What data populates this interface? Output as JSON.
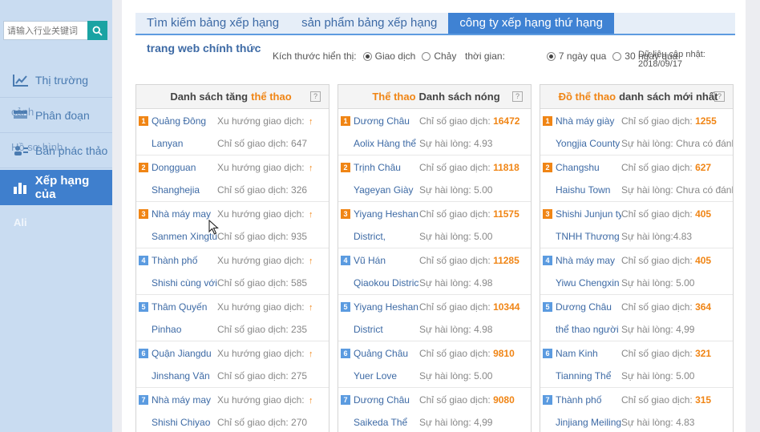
{
  "sidebar": {
    "search_placeholder": "请输入行业关键词",
    "items": [
      {
        "label": "Thị trường",
        "ghost": ""
      },
      {
        "label": "Phân đoạn",
        "ghost": "cảnh"
      },
      {
        "label": "Bản phác thảo",
        "ghost": "Hồ sơ hình"
      },
      {
        "label": "Xếp hạng của",
        "ghost": ""
      }
    ],
    "sub_label": "Ali"
  },
  "tabs": [
    {
      "label": "Tìm kiếm bảng xếp hạng",
      "active": false
    },
    {
      "label": "sản phẩm bảng xếp hạng",
      "active": false
    },
    {
      "label": "công ty xếp hạng thứ hạng",
      "active": true
    }
  ],
  "official_link": "trang web chính thức",
  "options": {
    "size_label": "Kích thước hiển thị:",
    "size_opts": [
      {
        "label": "Giao dịch",
        "checked": true
      },
      {
        "label": "Chảy",
        "checked": false
      }
    ],
    "time_label": "thời gian:",
    "time_opts": [
      {
        "label": "7 ngày qua",
        "checked": true
      },
      {
        "label": "30 ngày qua",
        "checked": false
      }
    ],
    "updated": "Dữ liệu cập nhật: 2018/09/17"
  },
  "panels": [
    {
      "title_before": "Danh sách tăng",
      "title_hl": "thể thao",
      "title_after": "",
      "rows": [
        {
          "rank": "1",
          "name": "Quảng Đông",
          "sub": "Lanyan",
          "m1_label": "Xu hướng giao dịch:",
          "m1_val": "",
          "m1_up": true,
          "m2": "Chỉ số giao dịch: 647"
        },
        {
          "rank": "2",
          "name": "Dongguan",
          "sub": "Shanghejia",
          "m1_label": "Xu hướng giao dịch:",
          "m1_val": "",
          "m1_up": true,
          "m2": "Chỉ số giao dịch: 326"
        },
        {
          "rank": "3",
          "name": "Nhà máy may",
          "sub": "Sanmen Xingtu",
          "m1_label": "Xu hướng giao dịch:",
          "m1_val": "",
          "m1_up": true,
          "m2": "Chỉ số giao dịch: 935"
        },
        {
          "rank": "4",
          "name": "Thành phố",
          "sub": "Shishi cùng với",
          "m1_label": "Xu hướng giao dịch:",
          "m1_val": "",
          "m1_up": true,
          "m2": "Chỉ số giao dịch: 585"
        },
        {
          "rank": "5",
          "name": "Thâm Quyến",
          "sub": "Pinhao",
          "m1_label": "Xu hướng giao dịch:",
          "m1_val": "",
          "m1_up": true,
          "m2": "Chỉ số giao dịch: 235"
        },
        {
          "rank": "6",
          "name": "Quận Jiangdu",
          "sub": "Jinshang Văn",
          "m1_label": "Xu hướng giao dịch:",
          "m1_val": "",
          "m1_up": true,
          "m2": "Chỉ số giao dịch: 275"
        },
        {
          "rank": "7",
          "name": "Nhà máy may",
          "sub": "Shishi Chiyao",
          "m1_label": "Xu hướng giao dịch:",
          "m1_val": "",
          "m1_up": true,
          "m2": "Chỉ số giao dịch: 270"
        }
      ]
    },
    {
      "title_before": "",
      "title_hl": "Thể thao",
      "title_after": "Danh sách nóng",
      "rows": [
        {
          "rank": "1",
          "name": "Dương Châu",
          "sub": "Aolix Hàng thể",
          "m1_label": "Chỉ số giao dịch:",
          "m1_val": "16472",
          "m1_up": false,
          "m2": "Sự hài lòng: 4.93"
        },
        {
          "rank": "2",
          "name": "Trịnh Châu",
          "sub": "Yageyan Giày",
          "m1_label": "Chỉ số giao dịch:",
          "m1_val": "11818",
          "m1_up": false,
          "m2": "Sự hài lòng: 5.00"
        },
        {
          "rank": "3",
          "name": "Yiyang Heshan",
          "sub": "District,",
          "m1_label": "Chỉ số giao dịch:",
          "m1_val": "11575",
          "m1_up": false,
          "m2": "Sự hài lòng: 5.00"
        },
        {
          "rank": "4",
          "name": "Vũ Hán",
          "sub": "Qiaokou District",
          "m1_label": "Chỉ số giao dịch:",
          "m1_val": "11285",
          "m1_up": false,
          "m2": "Sự hài lòng: 4.98"
        },
        {
          "rank": "5",
          "name": "Yiyang Heshan",
          "sub": "District",
          "m1_label": "Chỉ số giao dịch:",
          "m1_val": "10344",
          "m1_up": false,
          "m2": "Sự hài lòng: 4.98"
        },
        {
          "rank": "6",
          "name": "Quảng Châu",
          "sub": "Yuer Love",
          "m1_label": "Chỉ số giao dịch:",
          "m1_val": "9810",
          "m1_up": false,
          "m2": "Sự hài lòng: 5.00"
        },
        {
          "rank": "7",
          "name": "Dương Châu",
          "sub": "Saikeda Thể",
          "m1_label": "Chỉ số giao dịch:",
          "m1_val": "9080",
          "m1_up": false,
          "m2": "Sự hài lòng: 4,99"
        }
      ]
    },
    {
      "title_before": "",
      "title_hl": "Đồ thể thao",
      "title_after": "danh sách mới nhất",
      "rows": [
        {
          "rank": "1",
          "name": "Nhà máy giày",
          "sub": "Yongjia County",
          "m1_label": "Chỉ số giao dịch:",
          "m1_val": "1255",
          "m1_up": false,
          "m2": "Sự hài lòng: Chưa có đánh"
        },
        {
          "rank": "2",
          "name": "Changshu",
          "sub": "Haishu Town",
          "m1_label": "Chỉ số giao dịch:",
          "m1_val": "627",
          "m1_up": false,
          "m2": "Sự hài lòng: Chưa có đánh"
        },
        {
          "rank": "3",
          "name": "Shishi Junjun ty",
          "sub": "TNHH Thương",
          "m1_label": "Chỉ số giao dịch:",
          "m1_val": "405",
          "m1_up": false,
          "m2": "Sự hài lòng:4.83"
        },
        {
          "rank": "4",
          "name": "Nhà máy may",
          "sub": "Yiwu Chengxin",
          "m1_label": "Chỉ số giao dịch:",
          "m1_val": "405",
          "m1_up": false,
          "m2": "Sự hài lòng: 5.00"
        },
        {
          "rank": "5",
          "name": "Dương Châu",
          "sub": "thể thao người",
          "m1_label": "Chỉ số giao dịch:",
          "m1_val": "364",
          "m1_up": false,
          "m2": "Sự hài lòng: 4,99"
        },
        {
          "rank": "6",
          "name": "Nam Kinh",
          "sub": "Tianning Thể",
          "m1_label": "Chỉ số giao dịch:",
          "m1_val": "321",
          "m1_up": false,
          "m2": "Sự hài lòng: 5.00"
        },
        {
          "rank": "7",
          "name": "Thành phố",
          "sub": "Jinjiang Meiling",
          "m1_label": "Chỉ số giao dịch:",
          "m1_val": "315",
          "m1_up": false,
          "m2": "Sự hài lòng: 4.83"
        }
      ]
    }
  ],
  "colors": {
    "accent": "#f08515",
    "brand": "#3f82d3",
    "sidebar": "#c9dcf1"
  }
}
